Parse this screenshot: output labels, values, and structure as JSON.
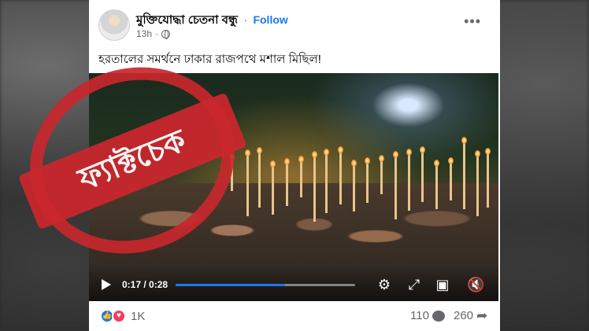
{
  "post": {
    "author": "মুক্তিযোদ্ধা চেতনা বন্ধু",
    "separator": "·",
    "follow_label": "Follow",
    "time": "13h",
    "time_separator": "·",
    "more_label": "•••",
    "caption": "হরতালের সমর্থনে ঢাকার রাজপথে মশাল মিছিল!"
  },
  "video": {
    "current_time": "0:17",
    "duration": "0:28",
    "progress": 0.61
  },
  "stamp": {
    "text": "ফ্যাক্টচেক",
    "color": "#c8272d"
  },
  "stats": {
    "reactions_count": "1K",
    "comments_count": "110",
    "shares_count": "260"
  },
  "colors": {
    "accent": "#1877f2",
    "love": "#f33e58"
  }
}
